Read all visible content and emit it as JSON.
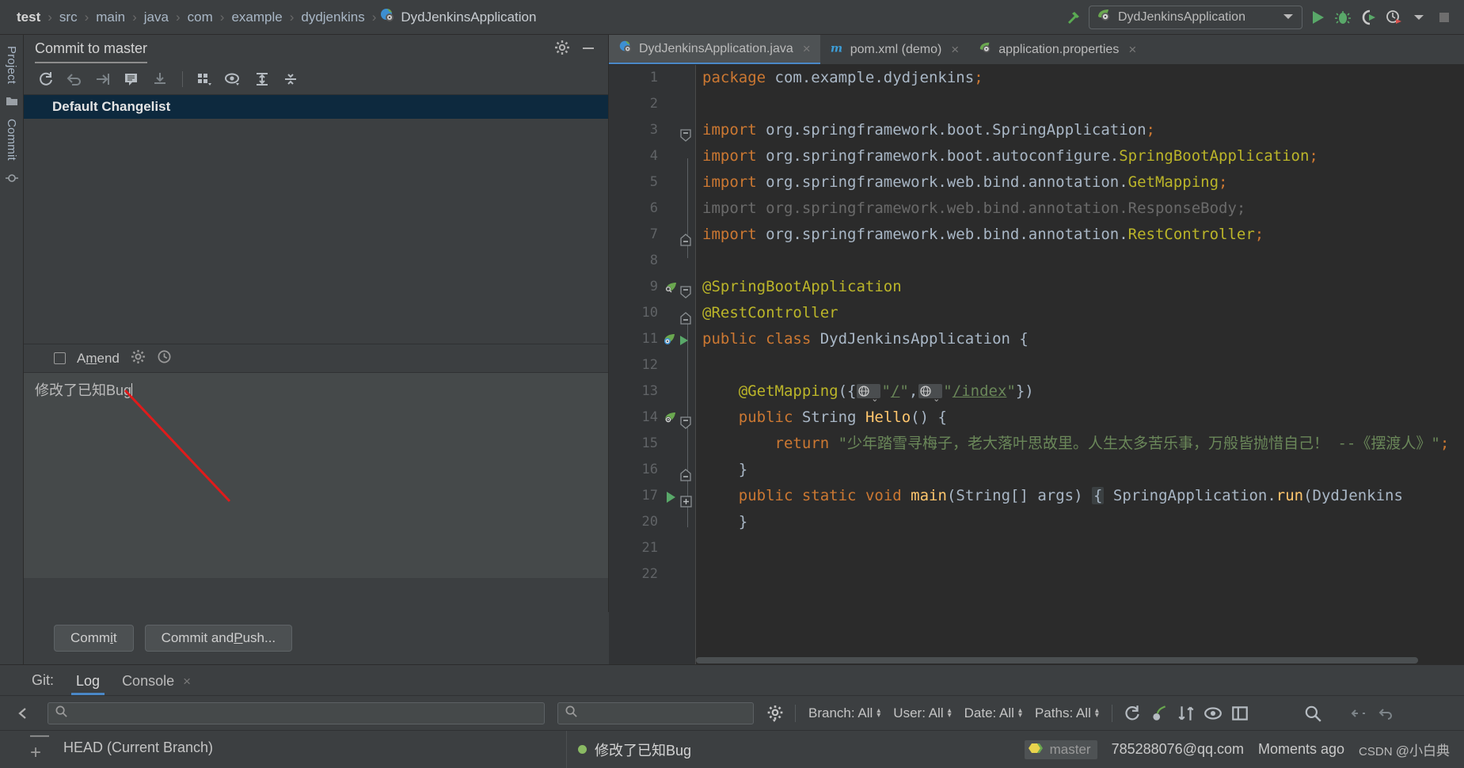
{
  "breadcrumb": {
    "items": [
      "test",
      "src",
      "main",
      "java",
      "com",
      "example",
      "dydjenkins"
    ],
    "file": "DydJenkinsApplication",
    "separator": "›"
  },
  "toolbar": {
    "run_config": "DydJenkinsApplication",
    "icons": [
      "hammer-build-icon",
      "run-icon",
      "debug-icon",
      "run-with-coverage-icon",
      "profiler-icon",
      "dropdown-icon",
      "stop-icon"
    ]
  },
  "left_rail": {
    "items": [
      "Project",
      "Commit"
    ]
  },
  "commit_panel": {
    "title": "Commit to master",
    "toolbar_icons": [
      "refresh-icon",
      "rollback-icon",
      "show-diff-icon",
      "annotate-icon",
      "update-icon",
      "group-by-icon",
      "preview-icon",
      "expand-all-icon",
      "collapse-all-icon"
    ],
    "header_icons": [
      "gear-icon",
      "minimize-icon"
    ],
    "changelist": "Default Changelist",
    "amend_label_pre": "A",
    "amend_label_accel": "m",
    "amend_label_post": "end",
    "amend_checked": false,
    "amend_icons": [
      "gear-icon",
      "history-icon"
    ],
    "message": "修改了已知Bug",
    "commit_button_pre": "Comm",
    "commit_button_accel": "i",
    "commit_button_post": "t",
    "push_button_pre": "Commit and ",
    "push_button_accel": "P",
    "push_button_post": "ush..."
  },
  "editor": {
    "tabs": [
      {
        "label": "DydJenkinsApplication.java",
        "icon": "java-class-spring-icon",
        "active": true,
        "close": "×"
      },
      {
        "label": "pom.xml (demo)",
        "icon": "maven-icon",
        "active": false,
        "close": "×"
      },
      {
        "label": "application.properties",
        "icon": "spring-leaf-icon",
        "active": false,
        "close": "×"
      }
    ],
    "lines": [
      {
        "num": "1",
        "gutter": "",
        "fold": "",
        "segments": [
          {
            "t": "package",
            "c": "kw"
          },
          {
            "t": " com.example.dydjenkins",
            "c": "id"
          },
          {
            "t": ";",
            "c": "semi"
          }
        ]
      },
      {
        "num": "2",
        "gutter": "",
        "fold": "",
        "segments": []
      },
      {
        "num": "3",
        "gutter": "",
        "fold": "open",
        "segments": [
          {
            "t": "import",
            "c": "kw"
          },
          {
            "t": " org.springframework.boot.",
            "c": "id"
          },
          {
            "t": "SpringApplication",
            "c": "id"
          },
          {
            "t": ";",
            "c": "semi"
          }
        ]
      },
      {
        "num": "4",
        "gutter": "",
        "fold": "",
        "segments": [
          {
            "t": "import",
            "c": "kw"
          },
          {
            "t": " org.springframework.boot.autoconfigure.",
            "c": "id"
          },
          {
            "t": "SpringBootApplication",
            "c": "ann"
          },
          {
            "t": ";",
            "c": "semi"
          }
        ]
      },
      {
        "num": "5",
        "gutter": "",
        "fold": "",
        "segments": [
          {
            "t": "import",
            "c": "kw"
          },
          {
            "t": " org.springframework.web.bind.annotation.",
            "c": "id"
          },
          {
            "t": "GetMapping",
            "c": "ann"
          },
          {
            "t": ";",
            "c": "semi"
          }
        ]
      },
      {
        "num": "6",
        "gutter": "",
        "fold": "",
        "segments": [
          {
            "t": "import org.springframework.web.bind.annotation.ResponseBody;",
            "c": "dim"
          }
        ]
      },
      {
        "num": "7",
        "gutter": "",
        "fold": "close",
        "segments": [
          {
            "t": "import",
            "c": "kw"
          },
          {
            "t": " org.springframework.web.bind.annotation.",
            "c": "id"
          },
          {
            "t": "RestController",
            "c": "ann"
          },
          {
            "t": ";",
            "c": "semi"
          }
        ]
      },
      {
        "num": "8",
        "gutter": "",
        "fold": "",
        "segments": []
      },
      {
        "num": "9",
        "gutter": "spring-bean-icon",
        "fold": "open",
        "segments": [
          {
            "t": "@SpringBootApplication",
            "c": "ann"
          }
        ]
      },
      {
        "num": "10",
        "gutter": "",
        "fold": "close",
        "segments": [
          {
            "t": "@RestController",
            "c": "ann"
          }
        ]
      },
      {
        "num": "11",
        "gutter": "spring-run-icons",
        "fold": "",
        "segments": [
          {
            "t": "public",
            "c": "kw"
          },
          {
            "t": " ",
            "c": "id"
          },
          {
            "t": "class",
            "c": "kw"
          },
          {
            "t": " DydJenkinsApplication {",
            "c": "id"
          }
        ]
      },
      {
        "num": "12",
        "gutter": "",
        "fold": "",
        "segments": []
      },
      {
        "num": "13",
        "gutter": "",
        "fold": "",
        "mapping": true,
        "segments": [
          {
            "t": "    @GetMapping",
            "c": "ann"
          },
          {
            "t": "({",
            "c": "id"
          }
        ],
        "url1": "/",
        "url2": "/index",
        "tail": "})"
      },
      {
        "num": "14",
        "gutter": "spring-mapping-icon",
        "fold": "open2",
        "segments": [
          {
            "t": "    ",
            "c": "id"
          },
          {
            "t": "public",
            "c": "kw"
          },
          {
            "t": " ",
            "c": "id"
          },
          {
            "t": "String",
            "c": "id"
          },
          {
            "t": " ",
            "c": "id"
          },
          {
            "t": "Hello",
            "c": "fn"
          },
          {
            "t": "() {",
            "c": "id"
          }
        ]
      },
      {
        "num": "15",
        "gutter": "",
        "fold": "",
        "segments": [
          {
            "t": "        ",
            "c": "id"
          },
          {
            "t": "return",
            "c": "kw"
          },
          {
            "t": " ",
            "c": "id"
          },
          {
            "t": "\"少年踏雪寻梅子，老大落叶思故里。人生太多苦乐事，万般皆抛惜自己！ --《摆渡人》\"",
            "c": "str"
          },
          {
            "t": ";",
            "c": "semi"
          }
        ]
      },
      {
        "num": "16",
        "gutter": "",
        "fold": "close2",
        "segments": [
          {
            "t": "    }",
            "c": "id"
          }
        ]
      },
      {
        "num": "17",
        "gutter": "run-method-icon",
        "fold": "plus",
        "folded": true,
        "segments": [
          {
            "t": "    ",
            "c": "id"
          },
          {
            "t": "public",
            "c": "kw"
          },
          {
            "t": " ",
            "c": "id"
          },
          {
            "t": "static",
            "c": "kw"
          },
          {
            "t": " ",
            "c": "id"
          },
          {
            "t": "void",
            "c": "kw"
          },
          {
            "t": " ",
            "c": "id"
          },
          {
            "t": "main",
            "c": "fn"
          },
          {
            "t": "(",
            "c": "id"
          },
          {
            "t": "String",
            "c": "id"
          },
          {
            "t": "[] args) ",
            "c": "id"
          }
        ],
        "fold_text": "{",
        "tail_segments": [
          {
            "t": " SpringApplication.",
            "c": "id"
          },
          {
            "t": "run",
            "c": "fn"
          },
          {
            "t": "(DydJenkins",
            "c": "id"
          }
        ]
      },
      {
        "num": "20",
        "gutter": "",
        "fold": "",
        "segments": [
          {
            "t": "    }",
            "c": "id"
          }
        ]
      },
      {
        "num": "21",
        "gutter": "",
        "fold": "",
        "segments": []
      },
      {
        "num": "22",
        "gutter": "",
        "fold": "",
        "segments": []
      }
    ]
  },
  "git_panel": {
    "label": "Git:",
    "tabs": [
      {
        "label": "Log",
        "active": true,
        "close": ""
      },
      {
        "label": "Console",
        "active": false,
        "close": "×"
      }
    ],
    "search_placeholder": "",
    "filters": [
      {
        "label": "Branch: All"
      },
      {
        "label": "User: All"
      },
      {
        "label": "Date: All"
      },
      {
        "label": "Paths: All"
      }
    ],
    "toolbar_icons": [
      "refresh-icon",
      "cherry-pick-icon",
      "sort-icon",
      "show-details-icon",
      "open-tab-icon",
      "search-icon",
      "collapse-icon",
      "undo-icon"
    ],
    "branch_head": "HEAD (Current Branch)",
    "commit": {
      "subject": "修改了已知Bug",
      "ref": "master",
      "author": "785288076@qq.com",
      "date": "Moments ago"
    },
    "watermark_left": "CSDN",
    "watermark_right": "@小白典"
  },
  "colors": {
    "panel_bg": "#3c3f41",
    "editor_bg": "#2b2b2b",
    "accent_blue": "#4a88c7",
    "selection_blue": "#0d293e",
    "annotation_yellow": "#bbb529",
    "keyword_orange": "#cc7832",
    "string_green": "#6a8759",
    "arrow_red": "#e01b1b",
    "spring_green": "#6aa84f"
  }
}
